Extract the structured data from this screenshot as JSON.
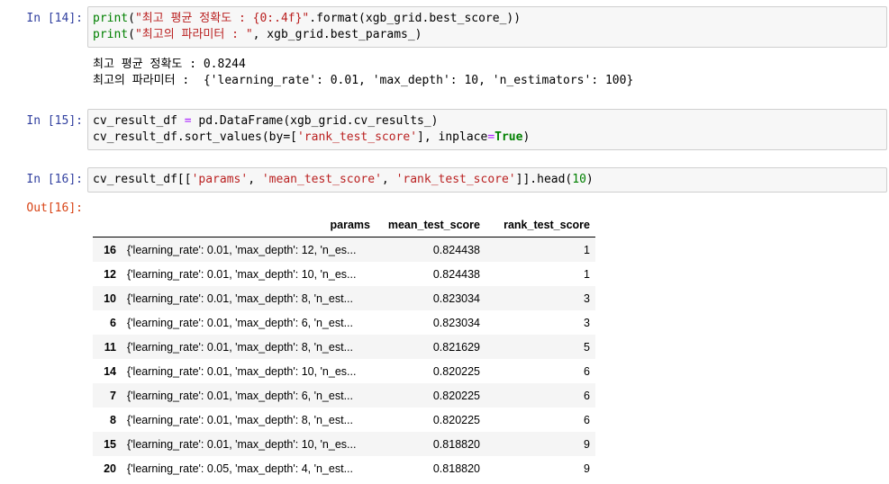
{
  "cells": [
    {
      "prompt": "In [14]:",
      "code": [
        [
          "print",
          "(",
          "\"최고 평균 정확도 : {0:.4f}\"",
          ".format(xgb_grid.best_score_))"
        ],
        [
          "print",
          "(",
          "\"최고의 파라미터 : \"",
          ", xgb_grid.best_params_)"
        ]
      ],
      "output": [
        "최고 평균 정확도 : 0.8244",
        "최고의 파라미터 :  {'learning_rate': 0.01, 'max_depth': 10, 'n_estimators': 100}"
      ]
    },
    {
      "prompt": "In [15]:",
      "line1": {
        "a": "cv_result_df ",
        "op": "=",
        "b": " pd.DataFrame(xgb_grid.cv_results_)"
      },
      "line2": {
        "a": "cv_result_df.sort_values(by=[",
        "s": "'rank_test_score'",
        "b": "], inplace",
        "op": "=",
        "t": "True",
        "c": ")"
      }
    },
    {
      "prompt": "In [16]:",
      "line": {
        "a": "cv_result_df[[",
        "s1": "'params'",
        "c1": ", ",
        "s2": "'mean_test_score'",
        "c2": ", ",
        "s3": "'rank_test_score'",
        "b": "]].head(",
        "n": "10",
        "c": ")"
      },
      "out_prompt": "Out[16]:"
    }
  ],
  "table": {
    "columns": [
      "params",
      "mean_test_score",
      "rank_test_score"
    ],
    "rows": [
      {
        "index": "16",
        "params": "{'learning_rate': 0.01, 'max_depth': 12, 'n_es...",
        "mean_test_score": "0.824438",
        "rank_test_score": "1"
      },
      {
        "index": "12",
        "params": "{'learning_rate': 0.01, 'max_depth': 10, 'n_es...",
        "mean_test_score": "0.824438",
        "rank_test_score": "1"
      },
      {
        "index": "10",
        "params": " {'learning_rate': 0.01, 'max_depth': 8, 'n_est...",
        "mean_test_score": "0.823034",
        "rank_test_score": "3"
      },
      {
        "index": "6",
        "params": " {'learning_rate': 0.01, 'max_depth': 6, 'n_est...",
        "mean_test_score": "0.823034",
        "rank_test_score": "3"
      },
      {
        "index": "11",
        "params": " {'learning_rate': 0.01, 'max_depth': 8, 'n_est...",
        "mean_test_score": "0.821629",
        "rank_test_score": "5"
      },
      {
        "index": "14",
        "params": "{'learning_rate': 0.01, 'max_depth': 10, 'n_es...",
        "mean_test_score": "0.820225",
        "rank_test_score": "6"
      },
      {
        "index": "7",
        "params": " {'learning_rate': 0.01, 'max_depth': 6, 'n_est...",
        "mean_test_score": "0.820225",
        "rank_test_score": "6"
      },
      {
        "index": "8",
        "params": " {'learning_rate': 0.01, 'max_depth': 8, 'n_est...",
        "mean_test_score": "0.820225",
        "rank_test_score": "6"
      },
      {
        "index": "15",
        "params": "{'learning_rate': 0.01, 'max_depth': 10, 'n_es...",
        "mean_test_score": "0.818820",
        "rank_test_score": "9"
      },
      {
        "index": "20",
        "params": " {'learning_rate': 0.05, 'max_depth': 4, 'n_est...",
        "mean_test_score": "0.818820",
        "rank_test_score": "9"
      }
    ]
  }
}
